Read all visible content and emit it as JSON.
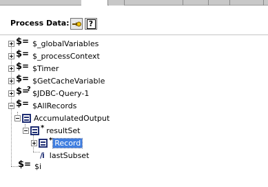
{
  "panel": {
    "title": "Process Data:"
  },
  "toolbar": {
    "map_icon": "map-variable-icon",
    "help_icon": "help-icon",
    "help_label": "?"
  },
  "tree": {
    "global_variables": "$_globalVariables",
    "process_context": "$_processContext",
    "timer": "$Timer",
    "get_cache_variable": "$GetCacheVariable",
    "jdbc_query": "$JDBC-Query-1",
    "all_records": "$AllRecords",
    "accumulated_output": "AccumulatedOutput",
    "result_set": "resultSet",
    "record": "Record",
    "last_subset": "lastSubset",
    "i_var": "$i"
  },
  "icons": {
    "dollar": "$",
    "equals": "=",
    "question": "?",
    "star": "*",
    "slash_i": "/i"
  },
  "colors": {
    "selection": "#3f7ee0",
    "record_icon": "#1e2d73"
  }
}
